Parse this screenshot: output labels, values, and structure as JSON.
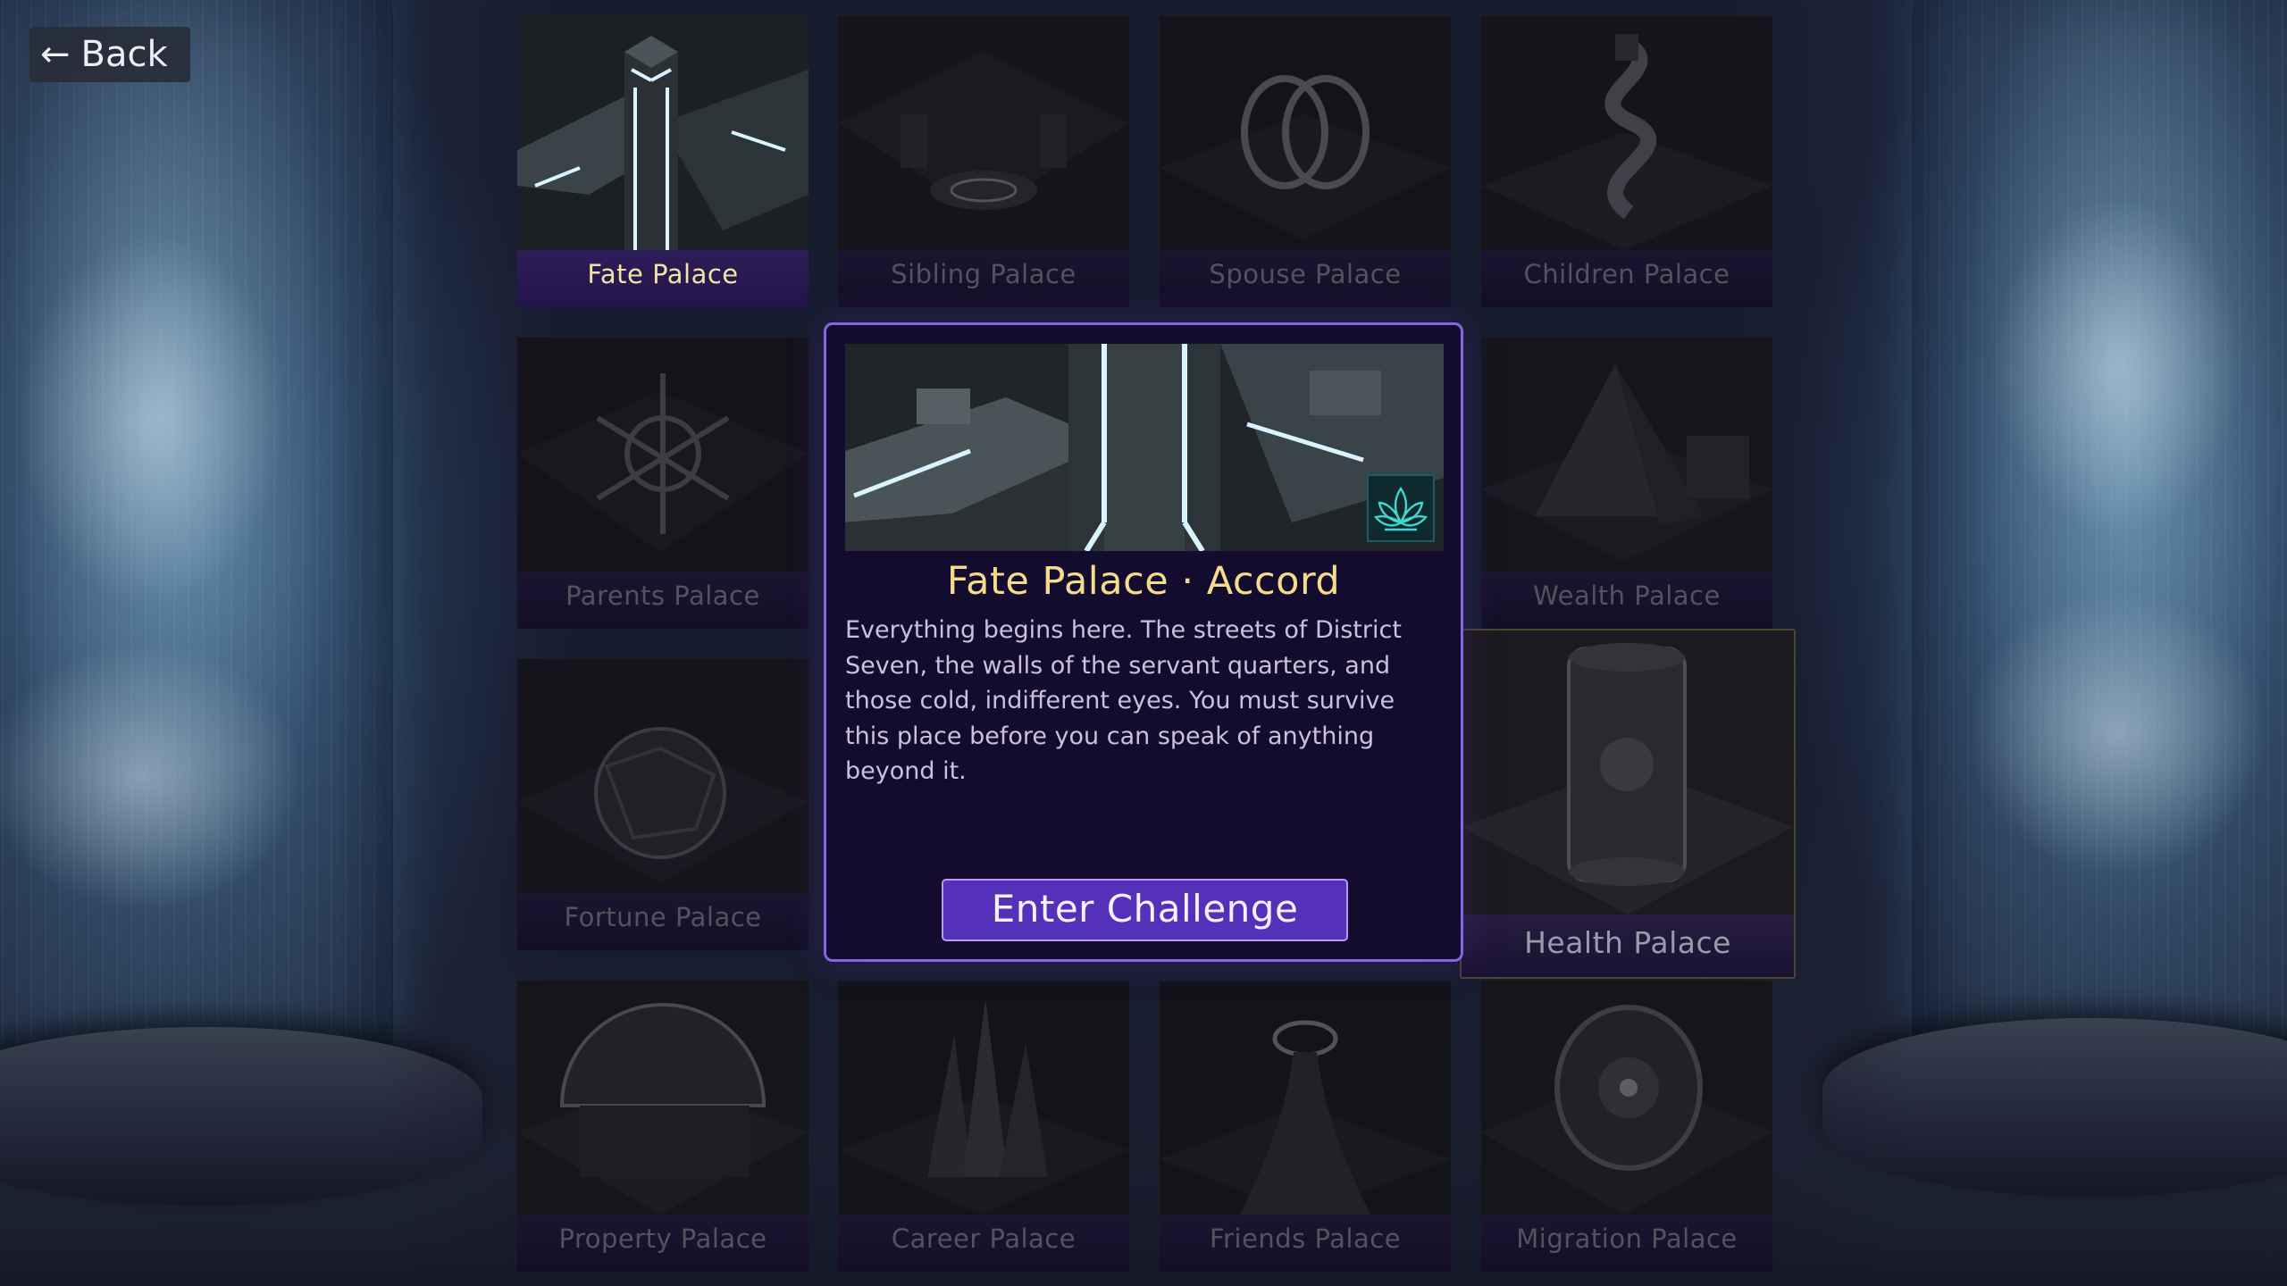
{
  "nav": {
    "back_label": "Back",
    "back_icon": "left-arrow-icon"
  },
  "palaces": [
    {
      "name": "Fate Palace",
      "state": "selected"
    },
    {
      "name": "Sibling Palace",
      "state": "locked"
    },
    {
      "name": "Spouse Palace",
      "state": "locked"
    },
    {
      "name": "Children Palace",
      "state": "locked"
    },
    {
      "name": "Parents Palace",
      "state": "locked"
    },
    {
      "name": "Wealth Palace",
      "state": "locked"
    },
    {
      "name": "Fortune Palace",
      "state": "locked"
    },
    {
      "name": "Health Palace",
      "state": "hovered"
    },
    {
      "name": "Property Palace",
      "state": "locked"
    },
    {
      "name": "Career Palace",
      "state": "locked"
    },
    {
      "name": "Friends Palace",
      "state": "locked"
    },
    {
      "name": "Migration Palace",
      "state": "locked"
    }
  ],
  "detail": {
    "title": "Fate Palace · Accord",
    "description": "Everything begins here. The streets of District Seven, the walls of the servant quarters, and those cold, indifferent eyes. You must survive this place before you can speak of anything beyond it.",
    "emblem_icon": "lotus-icon",
    "enter_label": "Enter Challenge"
  },
  "colors": {
    "accent": "#8a63e0",
    "button": "#5530b8",
    "title_gold": "#f4dc8c",
    "glow": "#d8f4ff",
    "emblem": "#3fd6d0"
  }
}
